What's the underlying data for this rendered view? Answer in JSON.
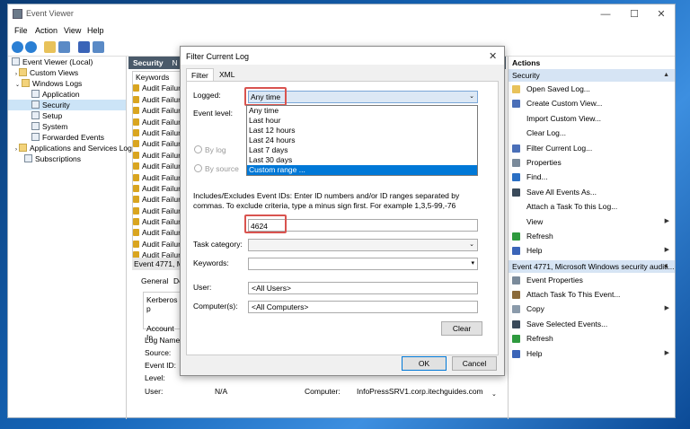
{
  "window": {
    "title": "Event Viewer"
  },
  "menu": [
    "File",
    "Action",
    "View",
    "Help"
  ],
  "tree": [
    {
      "label": "Event Viewer (Local)",
      "indent": 0
    },
    {
      "label": "Custom Views",
      "indent": 1
    },
    {
      "label": "Windows Logs",
      "indent": 1
    },
    {
      "label": "Application",
      "indent": 2
    },
    {
      "label": "Security",
      "indent": 2,
      "selected": true
    },
    {
      "label": "Setup",
      "indent": 2
    },
    {
      "label": "System",
      "indent": 2
    },
    {
      "label": "Forwarded Events",
      "indent": 2
    },
    {
      "label": "Applications and Services Log",
      "indent": 1
    },
    {
      "label": "Subscriptions",
      "indent": 1
    }
  ],
  "center": {
    "header": "Security",
    "header_tab": "N",
    "column": "Keywords",
    "row_label": "Audit Failur",
    "row_count": 16,
    "event_header": "Event 4771, Mi",
    "detail_tabs": [
      "General",
      "De"
    ],
    "detail_text1": "Kerberos p",
    "detail_text2": "Account In",
    "detail_fields": [
      "Log Name:",
      "Source:",
      "Event ID:",
      "Level:",
      "User:"
    ],
    "user_value": "N/A",
    "computer_label": "Computer:",
    "computer_value": "InfoPressSRV1.corp.itechguides.com"
  },
  "actions": {
    "title": "Actions",
    "group1": "Security",
    "items1": [
      {
        "label": "Open Saved Log...",
        "icon": "folder"
      },
      {
        "label": "Create Custom View...",
        "icon": "filter"
      },
      {
        "label": "Import Custom View...",
        "icon": ""
      },
      {
        "label": "Clear Log...",
        "icon": ""
      },
      {
        "label": "Filter Current Log...",
        "icon": "filter"
      },
      {
        "label": "Properties",
        "icon": "props"
      },
      {
        "label": "Find...",
        "icon": "find"
      },
      {
        "label": "Save All Events As...",
        "icon": "save"
      },
      {
        "label": "Attach a Task To this Log...",
        "icon": ""
      },
      {
        "label": "View",
        "icon": "",
        "submenu": true
      },
      {
        "label": "Refresh",
        "icon": "refresh"
      },
      {
        "label": "Help",
        "icon": "help",
        "submenu": true
      }
    ],
    "group2": "Event 4771, Microsoft Windows security auditi...",
    "items2": [
      {
        "label": "Event Properties",
        "icon": "props"
      },
      {
        "label": "Attach Task To This Event...",
        "icon": "task"
      },
      {
        "label": "Copy",
        "icon": "copy",
        "submenu": true
      },
      {
        "label": "Save Selected Events...",
        "icon": "save"
      },
      {
        "label": "Refresh",
        "icon": "refresh"
      },
      {
        "label": "Help",
        "icon": "help",
        "submenu": true
      }
    ]
  },
  "dialog": {
    "title": "Filter Current Log",
    "tabs": [
      "Filter",
      "XML"
    ],
    "logged_label": "Logged:",
    "logged_value": "Any time",
    "event_level_label": "Event level:",
    "options": [
      "Any time",
      "Last hour",
      "Last 12 hours",
      "Last 24 hours",
      "Last 7 days",
      "Last 30 days",
      "Custom range ..."
    ],
    "highlighted_option": 6,
    "by_log": "By log",
    "by_source": "By source",
    "includes_text": "Includes/Excludes Event IDs: Enter ID numbers and/or ID ranges separated by commas. To exclude criteria, type a minus sign first. For example 1,3,5-99,-76",
    "event_ids_value": "4624",
    "task_category_label": "Task category:",
    "keywords_label": "Keywords:",
    "user_label": "User:",
    "user_value": "<All Users>",
    "computer_label": "Computer(s):",
    "computer_value": "<All Computers>",
    "clear": "Clear",
    "ok": "OK",
    "cancel": "Cancel"
  }
}
